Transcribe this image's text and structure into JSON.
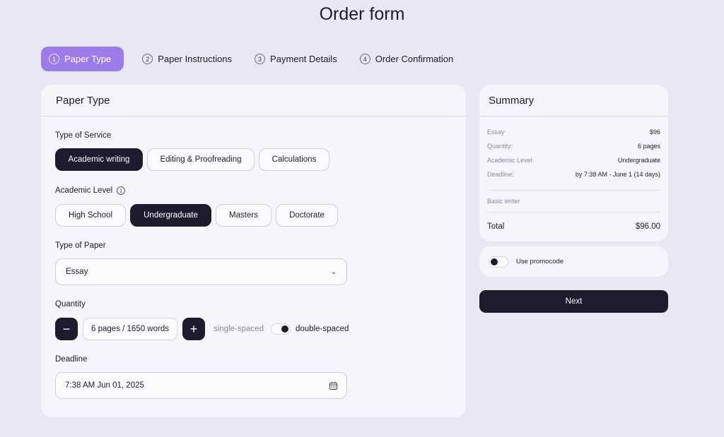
{
  "page": {
    "title": "Order form"
  },
  "steps": [
    {
      "num": "1",
      "label": "Paper Type"
    },
    {
      "num": "2",
      "label": "Paper Instructions"
    },
    {
      "num": "3",
      "label": "Payment Details"
    },
    {
      "num": "4",
      "label": "Order Confirmation"
    }
  ],
  "form": {
    "title": "Paper Type",
    "service": {
      "label": "Type of Service",
      "options": [
        "Academic writing",
        "Editing & Proofreading",
        "Calculations"
      ],
      "selected": "Academic writing"
    },
    "level": {
      "label": "Academic Level",
      "info_glyph": "i",
      "options": [
        "High School",
        "Undergraduate",
        "Masters",
        "Doctorate"
      ],
      "selected": "Undergraduate"
    },
    "paper_type": {
      "label": "Type of Paper",
      "value": "Essay",
      "chevron": "⌄"
    },
    "quantity": {
      "label": "Quantity",
      "minus": "−",
      "plus": "+",
      "value": "6 pages / 1650 words",
      "single_label": "single-spaced",
      "double_label": "double-spaced",
      "selected_spacing": "double-spaced"
    },
    "deadline": {
      "label": "Deadline",
      "value": "7:38 AM Jun 01, 2025"
    }
  },
  "summary": {
    "title": "Summary",
    "rows": [
      {
        "k": "Essay",
        "v": "$96"
      },
      {
        "k": "Quantity:",
        "v": "6 pages"
      },
      {
        "k": "Academic Level:",
        "v": "Undergraduate"
      },
      {
        "k": "Deadline:",
        "v": "by 7:38 AM - June 1 (14 days)"
      }
    ],
    "writer": "Basic writer",
    "total_label": "Total",
    "total_value": "$96.00"
  },
  "promo": {
    "label": "Use promocode",
    "enabled": false
  },
  "next_label": "Next",
  "colors": {
    "accent": "#9d7be8",
    "dark": "#1c1c2e",
    "background": "#e8e7f4",
    "card": "#f6f5fc"
  }
}
